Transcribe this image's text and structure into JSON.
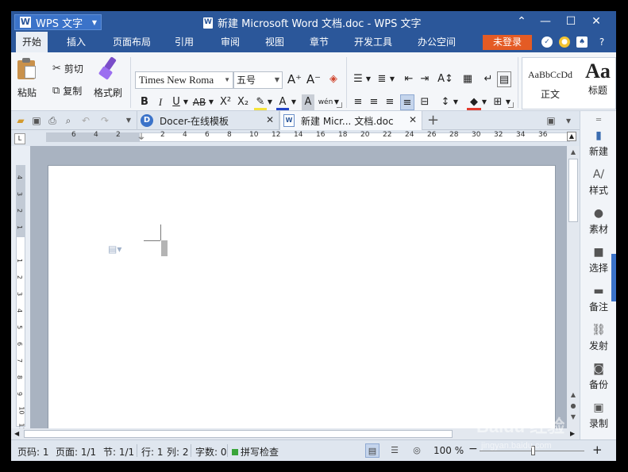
{
  "app": {
    "name": "WPS 文字",
    "logo": "W",
    "document_title": "新建 Microsoft Word 文档.doc - WPS 文字",
    "accent": "#2b579a"
  },
  "window_controls": {
    "ribbon_toggle": "⌃",
    "minimize": "—",
    "maximize": "☐",
    "close": "✕"
  },
  "menu": {
    "items": [
      {
        "label": "开始",
        "active": true
      },
      {
        "label": "插入",
        "active": false
      },
      {
        "label": "页面布局",
        "active": false
      },
      {
        "label": "引用",
        "active": false
      },
      {
        "label": "审阅",
        "active": false
      },
      {
        "label": "视图",
        "active": false
      },
      {
        "label": "章节",
        "active": false
      },
      {
        "label": "开发工具",
        "active": false
      },
      {
        "label": "办公空间",
        "active": false
      }
    ],
    "login_label": "未登录",
    "login_color": "#e45b24",
    "help_label": "?"
  },
  "ribbon": {
    "paste": "粘贴",
    "cut": "剪切",
    "copy": "复制",
    "format_painter": "格式刷",
    "font_name": "Times New Roma",
    "font_size": "五号",
    "format_buttons": {
      "bold": "B",
      "italic": "I",
      "underline": "U",
      "strikethrough": "AB",
      "superscript": "X²",
      "subscript": "X₂",
      "font_color": "A",
      "char_shading": "A",
      "phonetic": "wén"
    },
    "grow_font": "A⁺",
    "shrink_font": "A⁻",
    "styles": [
      {
        "sample": "AaBbCcDd",
        "name": "正文"
      },
      {
        "sample": "Aa",
        "name": "标题"
      }
    ]
  },
  "tabs": [
    {
      "label": "Docer-在线模板",
      "icon": "D",
      "active": false
    },
    {
      "label": "新建 Micr... 文档.doc",
      "icon": "W",
      "active": true
    }
  ],
  "ruler": {
    "ticks": [
      "6",
      "4",
      "2",
      "",
      "2",
      "4",
      "6",
      "8",
      "10",
      "12",
      "14",
      "16",
      "18",
      "20",
      "22",
      "24",
      "26",
      "28",
      "30",
      "32",
      "34",
      "36"
    ],
    "vticks": [
      "4",
      "3",
      "2",
      "1",
      "",
      "1",
      "2",
      "3",
      "4",
      "5",
      "6",
      "7",
      "8",
      "9",
      "10",
      "11"
    ]
  },
  "sidebar": {
    "items": [
      {
        "label": "新建",
        "icon": "new-doc"
      },
      {
        "label": "样式",
        "icon": "style"
      },
      {
        "label": "素材",
        "icon": "material"
      },
      {
        "label": "选择",
        "icon": "select"
      },
      {
        "label": "备注",
        "icon": "comment"
      },
      {
        "label": "发射",
        "icon": "link"
      },
      {
        "label": "备份",
        "icon": "backup"
      },
      {
        "label": "录制",
        "icon": "record"
      }
    ]
  },
  "status": {
    "page_num": "页码: 1",
    "page_count": "页面: 1/1",
    "section": "节: 1/1",
    "line": "行: 1",
    "column": "列: 2",
    "word_count": "字数: 0",
    "spell_check": "拼写检查",
    "zoom": "100 %",
    "zoom_level": 1.0
  },
  "watermark": {
    "brand": "Baidu 经验",
    "url": "jingyan.baidu.com"
  }
}
